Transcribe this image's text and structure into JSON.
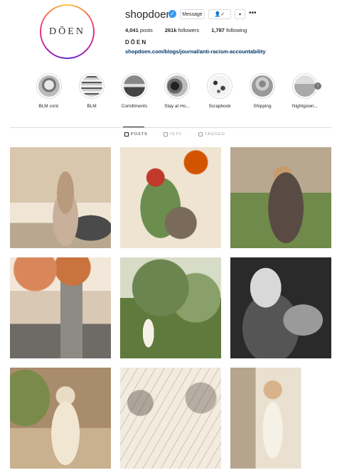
{
  "profile": {
    "avatar_text": "DŌEN",
    "username": "shopdoen",
    "message_button": "Message",
    "follow_button": "👤✓",
    "dropdown_button": "▾",
    "more_button": "•••",
    "posts_count": "4,041",
    "posts_label": "posts",
    "followers_count": "261k",
    "followers_label": "followers",
    "following_count": "1,787",
    "following_label": "following",
    "full_name": "DŌEN",
    "bio_link": "shopdoen.com/blogs/journal/anti-racism-accountability"
  },
  "highlights": [
    {
      "label": "BLM cont."
    },
    {
      "label": "BLM"
    },
    {
      "label": "Comittments"
    },
    {
      "label": "Stay at Ho..."
    },
    {
      "label": "Scrapbook"
    },
    {
      "label": "Shipping"
    },
    {
      "label": "Nightgown..."
    }
  ],
  "tabs": [
    {
      "label": "POSTS"
    },
    {
      "label": "IGTV"
    },
    {
      "label": "TAGGED"
    }
  ],
  "colors": {
    "link": "#003569",
    "verified": "#3897f0",
    "border": "#dbdbdb"
  }
}
